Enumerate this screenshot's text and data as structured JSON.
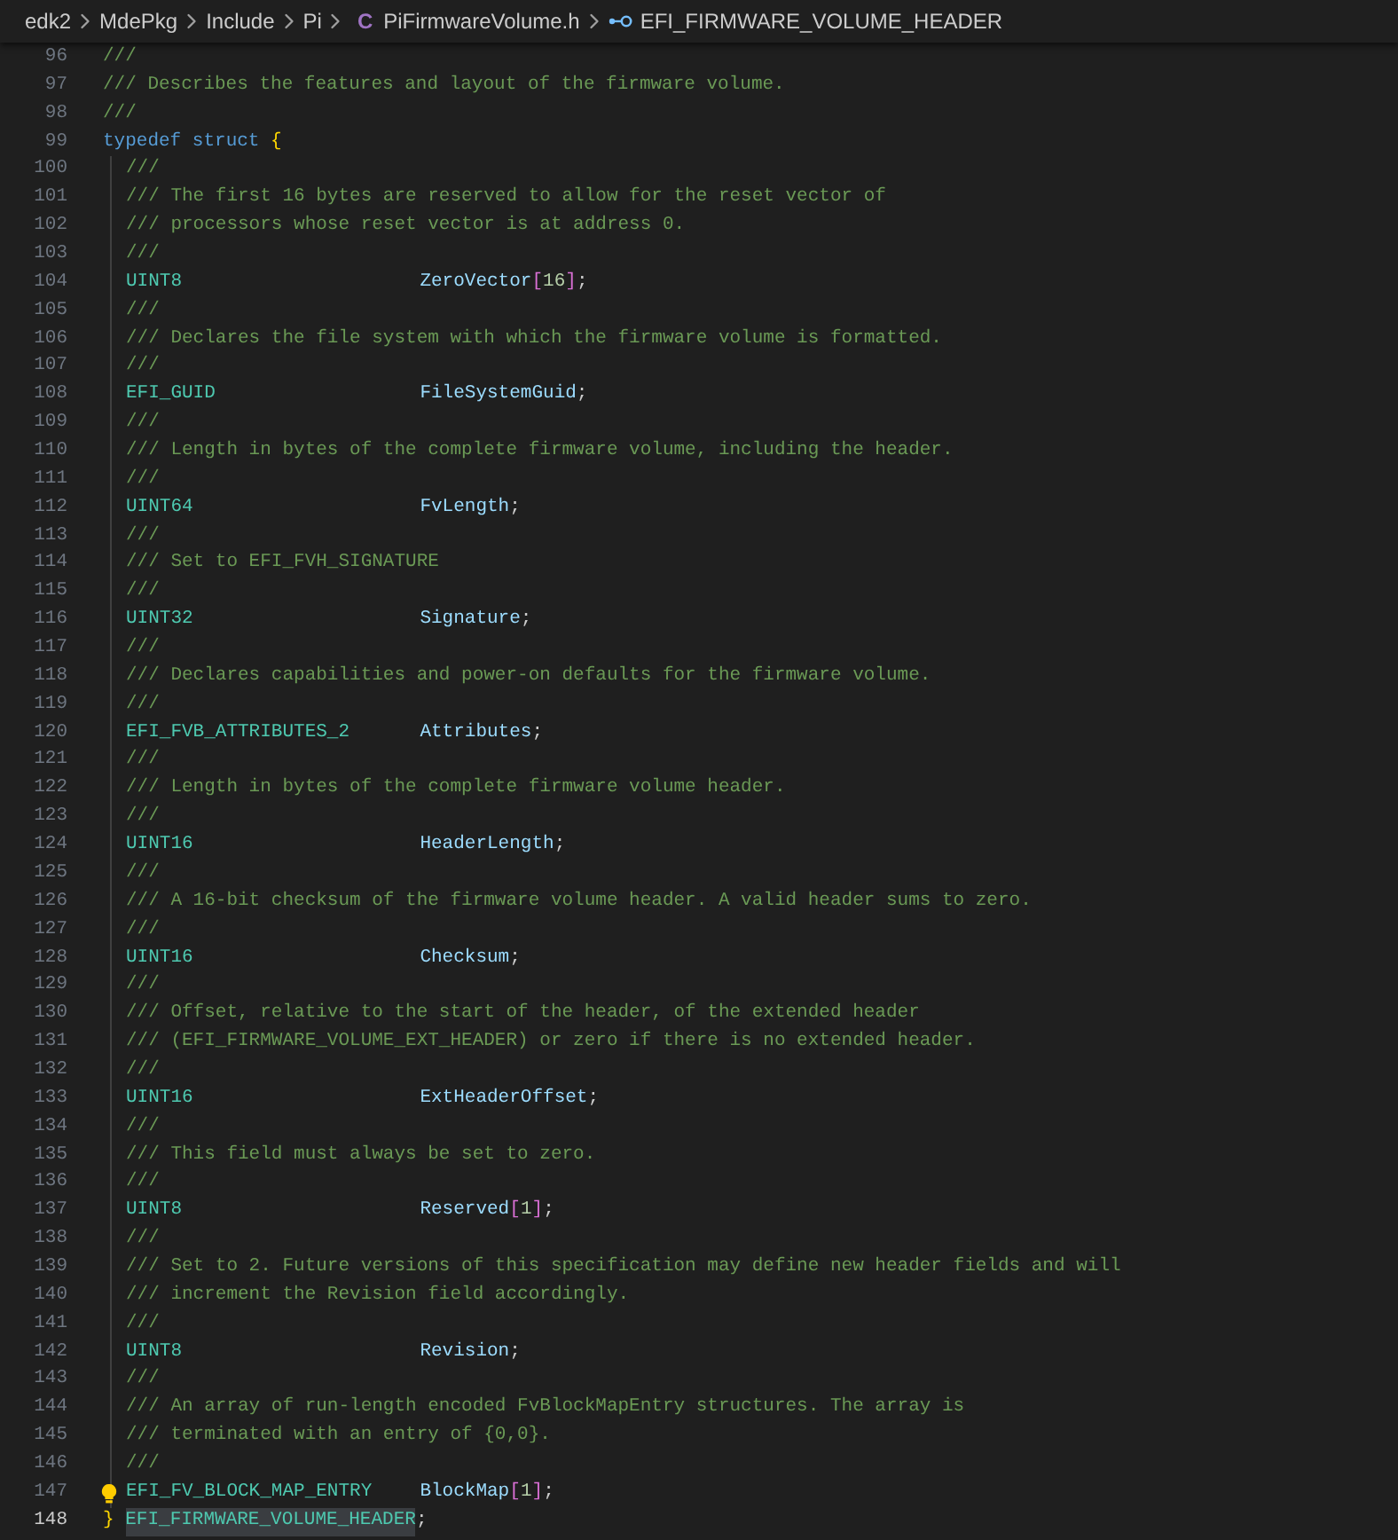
{
  "breadcrumb": [
    {
      "label": "edk2",
      "kind": "folder"
    },
    {
      "label": "MdePkg",
      "kind": "folder"
    },
    {
      "label": "Include",
      "kind": "folder"
    },
    {
      "label": "Pi",
      "kind": "folder"
    },
    {
      "label": "PiFirmwareVolume.h",
      "kind": "file",
      "icon_text": "C"
    },
    {
      "label": "EFI_FIRMWARE_VOLUME_HEADER",
      "kind": "symbol"
    }
  ],
  "lines": [
    {
      "number": "96",
      "indented": false,
      "current": false,
      "lightbulb": false,
      "tokens": [
        {
          "text": "///",
          "kind": "comment"
        }
      ]
    },
    {
      "number": "97",
      "indented": false,
      "current": false,
      "lightbulb": false,
      "tokens": [
        {
          "text": "/// Describes the features and layout of the firmware volume.",
          "kind": "comment"
        }
      ]
    },
    {
      "number": "98",
      "indented": false,
      "current": false,
      "lightbulb": false,
      "tokens": [
        {
          "text": "///",
          "kind": "comment"
        }
      ]
    },
    {
      "number": "99",
      "indented": false,
      "current": false,
      "lightbulb": false,
      "tokens": [
        {
          "text": "typedef ",
          "kind": "keyword"
        },
        {
          "text": "struct ",
          "kind": "keyword"
        },
        {
          "text": "{",
          "kind": "brace"
        }
      ]
    },
    {
      "number": "100",
      "indented": true,
      "current": false,
      "lightbulb": false,
      "tokens": [
        {
          "text": "///",
          "kind": "comment"
        }
      ]
    },
    {
      "number": "101",
      "indented": true,
      "current": false,
      "lightbulb": false,
      "tokens": [
        {
          "text": "/// The first 16 bytes are reserved to allow for the reset vector of",
          "kind": "comment"
        }
      ]
    },
    {
      "number": "102",
      "indented": true,
      "current": false,
      "lightbulb": false,
      "tokens": [
        {
          "text": "/// processors whose reset vector is at address 0.",
          "kind": "comment"
        }
      ]
    },
    {
      "number": "103",
      "indented": true,
      "current": false,
      "lightbulb": false,
      "tokens": [
        {
          "text": "///",
          "kind": "comment"
        }
      ]
    },
    {
      "number": "104",
      "indented": true,
      "current": false,
      "lightbulb": false,
      "tokens": [
        {
          "text": "UINT8",
          "kind": "type"
        },
        {
          "text": "ZeroVector",
          "kind": "name"
        },
        {
          "text": "[",
          "kind": "bracket"
        },
        {
          "text": "16",
          "kind": "number"
        },
        {
          "text": "]",
          "kind": "bracket"
        },
        {
          "text": ";",
          "kind": "punct"
        }
      ]
    },
    {
      "number": "105",
      "indented": true,
      "current": false,
      "lightbulb": false,
      "tokens": [
        {
          "text": "///",
          "kind": "comment"
        }
      ]
    },
    {
      "number": "106",
      "indented": true,
      "current": false,
      "lightbulb": false,
      "tokens": [
        {
          "text": "/// Declares the file system with which the firmware volume is formatted.",
          "kind": "comment"
        }
      ]
    },
    {
      "number": "107",
      "indented": true,
      "current": false,
      "lightbulb": false,
      "tokens": [
        {
          "text": "///",
          "kind": "comment"
        }
      ]
    },
    {
      "number": "108",
      "indented": true,
      "current": false,
      "lightbulb": false,
      "tokens": [
        {
          "text": "EFI_GUID",
          "kind": "type"
        },
        {
          "text": "FileSystemGuid",
          "kind": "name"
        },
        {
          "text": ";",
          "kind": "punct"
        }
      ]
    },
    {
      "number": "109",
      "indented": true,
      "current": false,
      "lightbulb": false,
      "tokens": [
        {
          "text": "///",
          "kind": "comment"
        }
      ]
    },
    {
      "number": "110",
      "indented": true,
      "current": false,
      "lightbulb": false,
      "tokens": [
        {
          "text": "/// Length in bytes of the complete firmware volume, including the header.",
          "kind": "comment"
        }
      ]
    },
    {
      "number": "111",
      "indented": true,
      "current": false,
      "lightbulb": false,
      "tokens": [
        {
          "text": "///",
          "kind": "comment"
        }
      ]
    },
    {
      "number": "112",
      "indented": true,
      "current": false,
      "lightbulb": false,
      "tokens": [
        {
          "text": "UINT64",
          "kind": "type"
        },
        {
          "text": "FvLength",
          "kind": "name"
        },
        {
          "text": ";",
          "kind": "punct"
        }
      ]
    },
    {
      "number": "113",
      "indented": true,
      "current": false,
      "lightbulb": false,
      "tokens": [
        {
          "text": "///",
          "kind": "comment"
        }
      ]
    },
    {
      "number": "114",
      "indented": true,
      "current": false,
      "lightbulb": false,
      "tokens": [
        {
          "text": "/// Set to EFI_FVH_SIGNATURE",
          "kind": "comment"
        }
      ]
    },
    {
      "number": "115",
      "indented": true,
      "current": false,
      "lightbulb": false,
      "tokens": [
        {
          "text": "///",
          "kind": "comment"
        }
      ]
    },
    {
      "number": "116",
      "indented": true,
      "current": false,
      "lightbulb": false,
      "tokens": [
        {
          "text": "UINT32",
          "kind": "type"
        },
        {
          "text": "Signature",
          "kind": "name"
        },
        {
          "text": ";",
          "kind": "punct"
        }
      ]
    },
    {
      "number": "117",
      "indented": true,
      "current": false,
      "lightbulb": false,
      "tokens": [
        {
          "text": "///",
          "kind": "comment"
        }
      ]
    },
    {
      "number": "118",
      "indented": true,
      "current": false,
      "lightbulb": false,
      "tokens": [
        {
          "text": "/// Declares capabilities and power-on defaults for the firmware volume.",
          "kind": "comment"
        }
      ]
    },
    {
      "number": "119",
      "indented": true,
      "current": false,
      "lightbulb": false,
      "tokens": [
        {
          "text": "///",
          "kind": "comment"
        }
      ]
    },
    {
      "number": "120",
      "indented": true,
      "current": false,
      "lightbulb": false,
      "tokens": [
        {
          "text": "EFI_FVB_ATTRIBUTES_2",
          "kind": "type"
        },
        {
          "text": "Attributes",
          "kind": "name"
        },
        {
          "text": ";",
          "kind": "punct"
        }
      ]
    },
    {
      "number": "121",
      "indented": true,
      "current": false,
      "lightbulb": false,
      "tokens": [
        {
          "text": "///",
          "kind": "comment"
        }
      ]
    },
    {
      "number": "122",
      "indented": true,
      "current": false,
      "lightbulb": false,
      "tokens": [
        {
          "text": "/// Length in bytes of the complete firmware volume header.",
          "kind": "comment"
        }
      ]
    },
    {
      "number": "123",
      "indented": true,
      "current": false,
      "lightbulb": false,
      "tokens": [
        {
          "text": "///",
          "kind": "comment"
        }
      ]
    },
    {
      "number": "124",
      "indented": true,
      "current": false,
      "lightbulb": false,
      "tokens": [
        {
          "text": "UINT16",
          "kind": "type"
        },
        {
          "text": "HeaderLength",
          "kind": "name"
        },
        {
          "text": ";",
          "kind": "punct"
        }
      ]
    },
    {
      "number": "125",
      "indented": true,
      "current": false,
      "lightbulb": false,
      "tokens": [
        {
          "text": "///",
          "kind": "comment"
        }
      ]
    },
    {
      "number": "126",
      "indented": true,
      "current": false,
      "lightbulb": false,
      "tokens": [
        {
          "text": "/// A 16-bit checksum of the firmware volume header. A valid header sums to zero.",
          "kind": "comment"
        }
      ]
    },
    {
      "number": "127",
      "indented": true,
      "current": false,
      "lightbulb": false,
      "tokens": [
        {
          "text": "///",
          "kind": "comment"
        }
      ]
    },
    {
      "number": "128",
      "indented": true,
      "current": false,
      "lightbulb": false,
      "tokens": [
        {
          "text": "UINT16",
          "kind": "type"
        },
        {
          "text": "Checksum",
          "kind": "name"
        },
        {
          "text": ";",
          "kind": "punct"
        }
      ]
    },
    {
      "number": "129",
      "indented": true,
      "current": false,
      "lightbulb": false,
      "tokens": [
        {
          "text": "///",
          "kind": "comment"
        }
      ]
    },
    {
      "number": "130",
      "indented": true,
      "current": false,
      "lightbulb": false,
      "tokens": [
        {
          "text": "/// Offset, relative to the start of the header, of the extended header",
          "kind": "comment"
        }
      ]
    },
    {
      "number": "131",
      "indented": true,
      "current": false,
      "lightbulb": false,
      "tokens": [
        {
          "text": "/// (EFI_FIRMWARE_VOLUME_EXT_HEADER) or zero if there is no extended header.",
          "kind": "comment"
        }
      ]
    },
    {
      "number": "132",
      "indented": true,
      "current": false,
      "lightbulb": false,
      "tokens": [
        {
          "text": "///",
          "kind": "comment"
        }
      ]
    },
    {
      "number": "133",
      "indented": true,
      "current": false,
      "lightbulb": false,
      "tokens": [
        {
          "text": "UINT16",
          "kind": "type"
        },
        {
          "text": "ExtHeaderOffset",
          "kind": "name"
        },
        {
          "text": ";",
          "kind": "punct"
        }
      ]
    },
    {
      "number": "134",
      "indented": true,
      "current": false,
      "lightbulb": false,
      "tokens": [
        {
          "text": "///",
          "kind": "comment"
        }
      ]
    },
    {
      "number": "135",
      "indented": true,
      "current": false,
      "lightbulb": false,
      "tokens": [
        {
          "text": "/// This field must always be set to zero.",
          "kind": "comment"
        }
      ]
    },
    {
      "number": "136",
      "indented": true,
      "current": false,
      "lightbulb": false,
      "tokens": [
        {
          "text": "///",
          "kind": "comment"
        }
      ]
    },
    {
      "number": "137",
      "indented": true,
      "current": false,
      "lightbulb": false,
      "tokens": [
        {
          "text": "UINT8",
          "kind": "type"
        },
        {
          "text": "Reserved",
          "kind": "name"
        },
        {
          "text": "[",
          "kind": "bracket"
        },
        {
          "text": "1",
          "kind": "number"
        },
        {
          "text": "]",
          "kind": "bracket"
        },
        {
          "text": ";",
          "kind": "punct"
        }
      ]
    },
    {
      "number": "138",
      "indented": true,
      "current": false,
      "lightbulb": false,
      "tokens": [
        {
          "text": "///",
          "kind": "comment"
        }
      ]
    },
    {
      "number": "139",
      "indented": true,
      "current": false,
      "lightbulb": false,
      "tokens": [
        {
          "text": "/// Set to 2. Future versions of this specification may define new header fields and will",
          "kind": "comment"
        }
      ]
    },
    {
      "number": "140",
      "indented": true,
      "current": false,
      "lightbulb": false,
      "tokens": [
        {
          "text": "/// increment the Revision field accordingly.",
          "kind": "comment"
        }
      ]
    },
    {
      "number": "141",
      "indented": true,
      "current": false,
      "lightbulb": false,
      "tokens": [
        {
          "text": "///",
          "kind": "comment"
        }
      ]
    },
    {
      "number": "142",
      "indented": true,
      "current": false,
      "lightbulb": false,
      "tokens": [
        {
          "text": "UINT8",
          "kind": "type"
        },
        {
          "text": "Revision",
          "kind": "name"
        },
        {
          "text": ";",
          "kind": "punct"
        }
      ]
    },
    {
      "number": "143",
      "indented": true,
      "current": false,
      "lightbulb": false,
      "tokens": [
        {
          "text": "///",
          "kind": "comment"
        }
      ]
    },
    {
      "number": "144",
      "indented": true,
      "current": false,
      "lightbulb": false,
      "tokens": [
        {
          "text": "/// An array of run-length encoded FvBlockMapEntry structures. The array is",
          "kind": "comment"
        }
      ]
    },
    {
      "number": "145",
      "indented": true,
      "current": false,
      "lightbulb": false,
      "tokens": [
        {
          "text": "/// terminated with an entry of {0,0}.",
          "kind": "comment"
        }
      ]
    },
    {
      "number": "146",
      "indented": true,
      "current": false,
      "lightbulb": false,
      "tokens": [
        {
          "text": "///",
          "kind": "comment"
        }
      ]
    },
    {
      "number": "147",
      "indented": true,
      "current": false,
      "lightbulb": true,
      "tokens": [
        {
          "text": "EFI_FV_BLOCK_MAP_ENTRY",
          "kind": "type"
        },
        {
          "text": "BlockMap",
          "kind": "name"
        },
        {
          "text": "[",
          "kind": "bracket"
        },
        {
          "text": "1",
          "kind": "number"
        },
        {
          "text": "]",
          "kind": "bracket"
        },
        {
          "text": ";",
          "kind": "punct"
        }
      ]
    },
    {
      "number": "148",
      "indented": false,
      "current": true,
      "lightbulb": false,
      "tokens": [
        {
          "text": "} ",
          "kind": "brace"
        },
        {
          "text": "EFI_FIRMWARE_VOLUME_HEADER",
          "kind": "typedef-name",
          "selected": true
        },
        {
          "text": ";",
          "kind": "punct"
        }
      ]
    }
  ]
}
